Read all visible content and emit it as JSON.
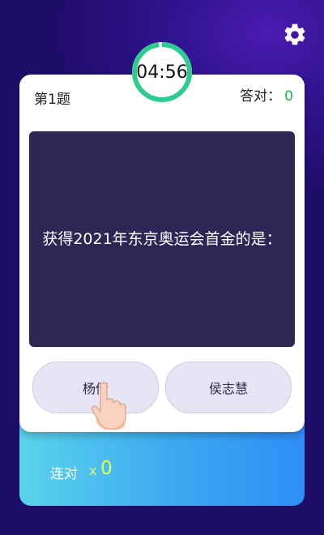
{
  "timer": {
    "display": "04:56",
    "progress": 0.98
  },
  "header": {
    "question_index": "第1题",
    "score_label": "答对：",
    "score_value": "0"
  },
  "question": {
    "text": "获得2021年东京奥运会首金的是："
  },
  "options": [
    {
      "label": "杨倩"
    },
    {
      "label": "侯志慧"
    }
  ],
  "streak": {
    "label": "连对",
    "multiplier": "x",
    "count": "0"
  },
  "colors": {
    "accent_green": "#2ecc8f",
    "score_green": "#22b14c",
    "streak_yellow": "#dfff5c",
    "card_dark": "#2e2755"
  },
  "icons": {
    "settings": "gear-icon",
    "hint": "pointing-hand-icon"
  }
}
